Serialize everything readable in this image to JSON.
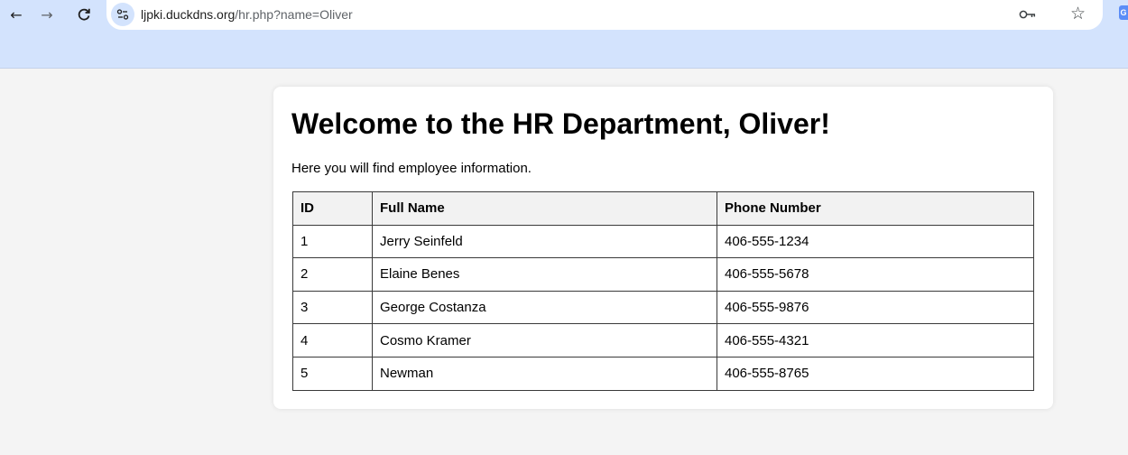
{
  "browser": {
    "url_domain": "ljpki.duckdns.org",
    "url_path": "/hr.php?name=Oliver",
    "back_glyph": "←",
    "forward_glyph": "→",
    "reload_glyph": "C",
    "star_glyph": "☆",
    "extension_glyph": "G",
    "icons": [
      "back-arrow-icon",
      "forward-arrow-icon",
      "reload-icon",
      "site-info-icon",
      "key-icon",
      "star-icon",
      "extension-icon"
    ]
  },
  "page": {
    "title": "Welcome to the HR Department, Oliver!",
    "intro": "Here you will find employee information.",
    "table": {
      "headers": [
        "ID",
        "Full Name",
        "Phone Number"
      ],
      "rows": [
        [
          "1",
          "Jerry Seinfeld",
          "406-555-1234"
        ],
        [
          "2",
          "Elaine Benes",
          "406-555-5678"
        ],
        [
          "3",
          "George Costanza",
          "406-555-9876"
        ],
        [
          "4",
          "Cosmo Kramer",
          "406-555-4321"
        ],
        [
          "5",
          "Newman",
          "406-555-8765"
        ]
      ]
    }
  },
  "colors": {
    "toolbar_bg": "#d3e3fd",
    "page_bg": "#f4f4f4",
    "card_bg": "#ffffff",
    "header_row_bg": "#f2f2f2"
  }
}
